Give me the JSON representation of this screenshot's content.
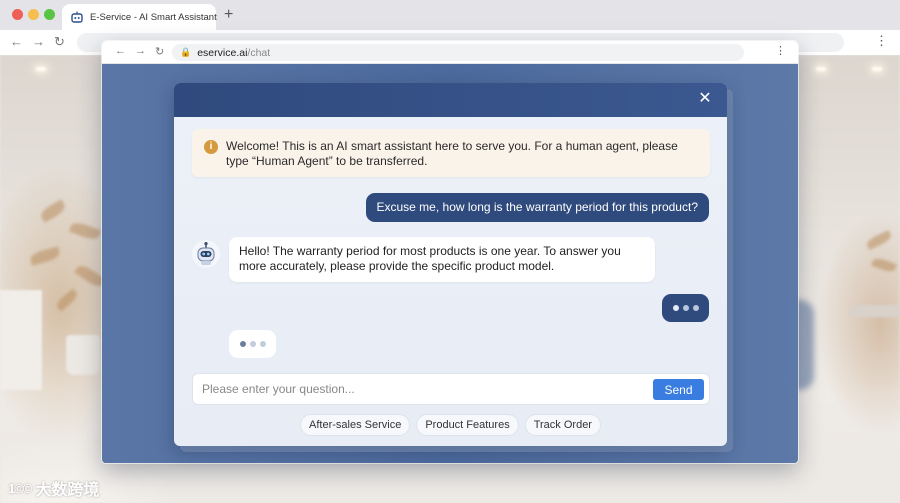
{
  "browser": {
    "tab_title": "E-Service - AI Smart Assistant",
    "new_tab_symbol": "+",
    "back_symbol": "←",
    "forward_symbol": "→",
    "reload_symbol": "↻",
    "menu_symbol": "⋮"
  },
  "inner_browser": {
    "url_host": "eservice.ai",
    "url_path": "/chat",
    "lock_symbol": "🔒",
    "back_symbol": "←",
    "forward_symbol": "→",
    "reload_symbol": "↻",
    "menu_symbol": "⋮"
  },
  "chat": {
    "close_symbol": "✕",
    "notice_icon": "i",
    "notice": "Welcome! This is an AI smart assistant here to serve you. For a human agent, please type “Human Agent” to be transferred.",
    "messages": [
      {
        "role": "user",
        "text": "Excuse me, how long is the warranty period for this product?"
      },
      {
        "role": "bot",
        "text": "Hello! The warranty period for most products is one year. To answer you more accurately, please provide the specific product model."
      }
    ],
    "input_placeholder": "Please enter your question...",
    "send_label": "Send",
    "quick_replies": [
      "After-sales Service",
      "Product Features",
      "Track Order"
    ]
  },
  "watermark": {
    "logo": "1©©",
    "text": "大数跨境"
  },
  "colors": {
    "header": "#2f4a7d",
    "user_bubble": "#2f4a7d",
    "send_button": "#3a7de0",
    "notice_bg": "#faf3ea",
    "notice_icon": "#d59a3d"
  }
}
